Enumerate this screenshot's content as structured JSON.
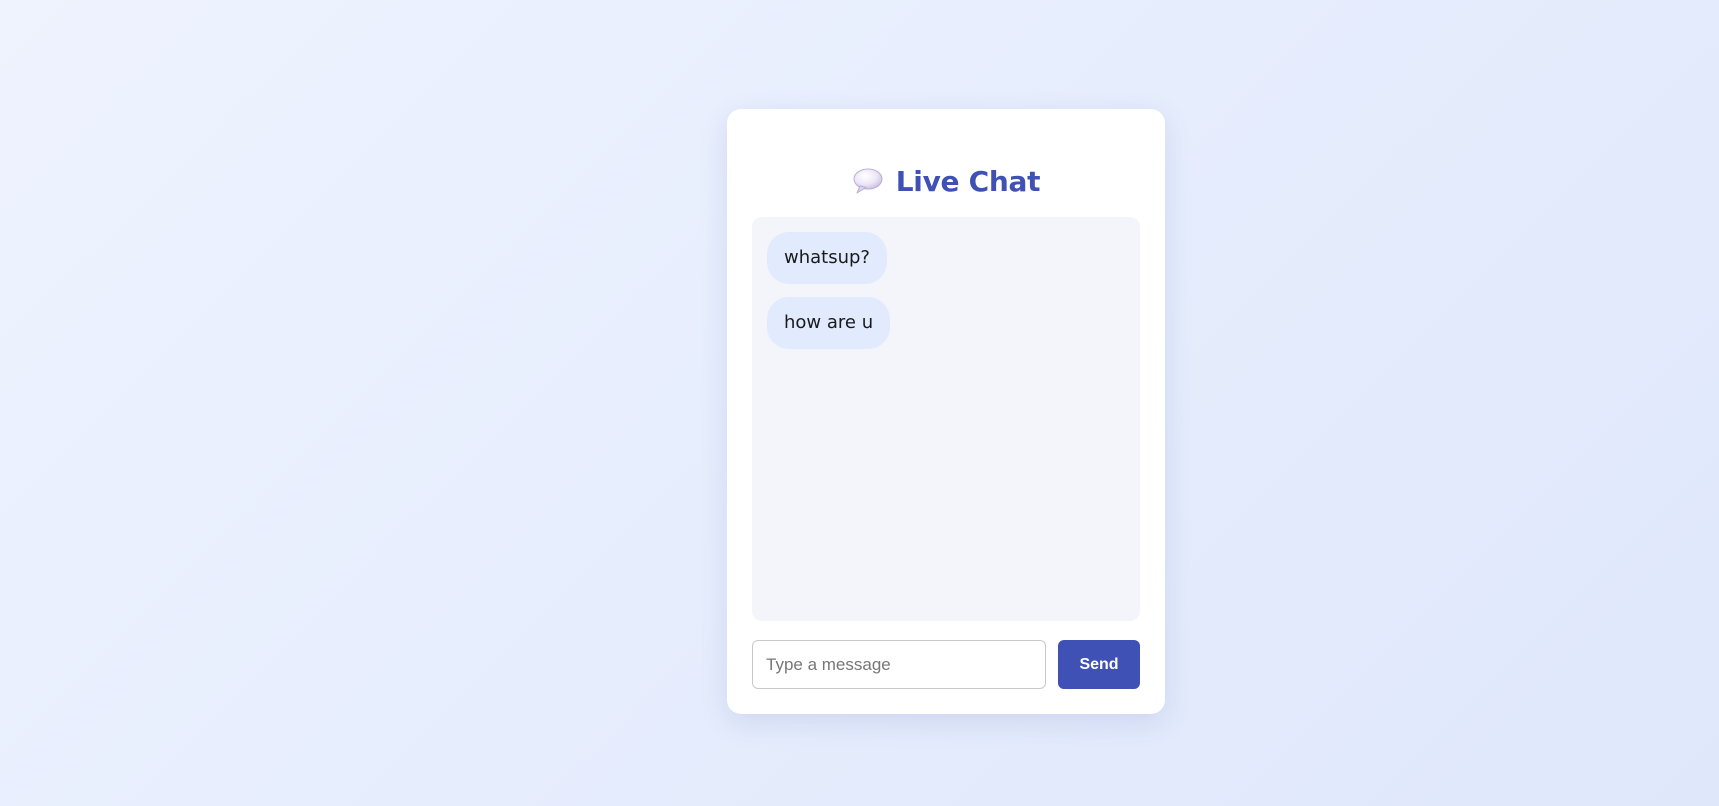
{
  "header": {
    "icon": "speech-bubble-icon",
    "title": "Live Chat"
  },
  "messages": [
    {
      "text": "whatsup?"
    },
    {
      "text": "how are u"
    }
  ],
  "composer": {
    "placeholder": "Type a message",
    "value": "",
    "send_label": "Send"
  },
  "colors": {
    "accent": "#3f51b5",
    "bubble": "#e2eafe",
    "pane": "#f3f5fb",
    "background": "#e6edfd"
  }
}
